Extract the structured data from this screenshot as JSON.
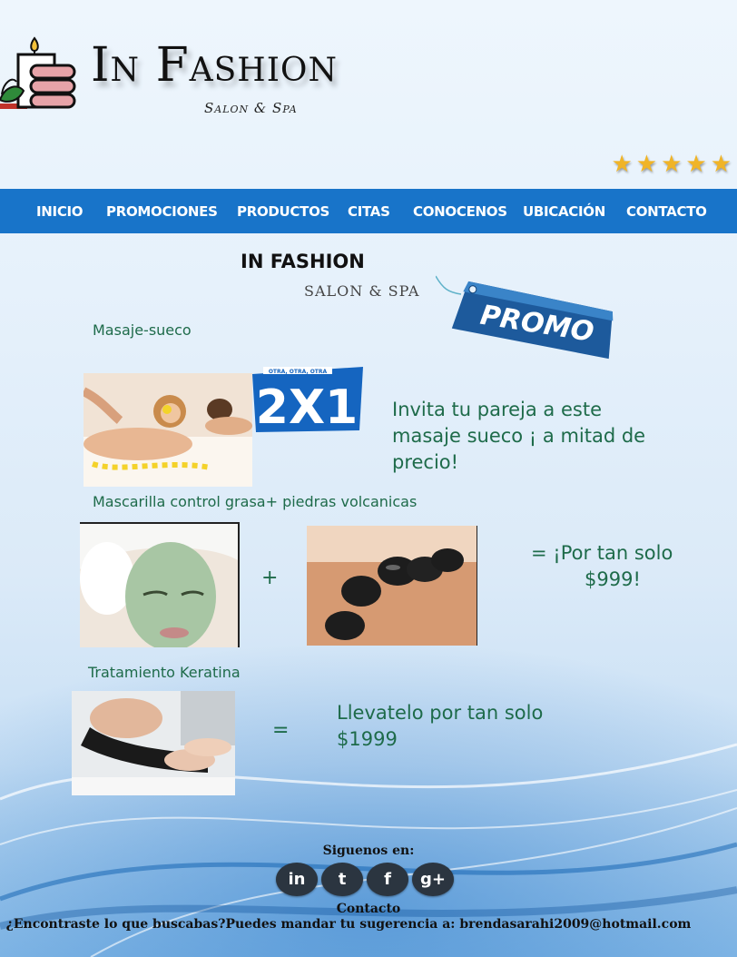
{
  "header": {
    "logo_title": "In Fashion",
    "logo_sub": "Salon & Spa",
    "rating_stars": 5
  },
  "nav": {
    "items": [
      "INICIO",
      "PROMOCIONES",
      "PRODUCTOS",
      "CITAS",
      "CONOCENOS",
      "UBICACIÓN",
      "CONTACTO"
    ]
  },
  "main": {
    "brand_title": "IN FASHION",
    "brand_sub": "SALON & SPA",
    "promo_tag": "PROMO",
    "promos": [
      {
        "label": "Masaje-sueco",
        "badge": "2X1",
        "badge_top": "OTRA, OTRA, OTRA",
        "description": "Invita tu pareja a este masaje sueco ¡ a mitad de precio!"
      },
      {
        "label": "Mascarilla control grasa+ piedras volcanicas",
        "plus": "+",
        "price_line1": "= ¡Por tan solo",
        "price_line2": "$999!"
      },
      {
        "label": "Tratamiento Keratina",
        "equals": "=",
        "price_line1": "Llevatelo por tan solo",
        "price_line2": "$1999"
      }
    ]
  },
  "footer": {
    "follow_label": "Siguenos en:",
    "social": [
      {
        "icon": "linkedin-icon",
        "glyph": "in"
      },
      {
        "icon": "twitter-icon",
        "glyph": "t"
      },
      {
        "icon": "facebook-icon",
        "glyph": "f"
      },
      {
        "icon": "googleplus-icon",
        "glyph": "g+"
      }
    ],
    "contact_heading": "Contacto",
    "suggestion": "¿Encontraste lo que buscabas?Puedes mandar tu sugerencia a: brendasarahi2009@hotmail.com"
  },
  "colors": {
    "nav": "#1874c9",
    "green_text": "#1e6b4a",
    "star": "#f0b428"
  }
}
